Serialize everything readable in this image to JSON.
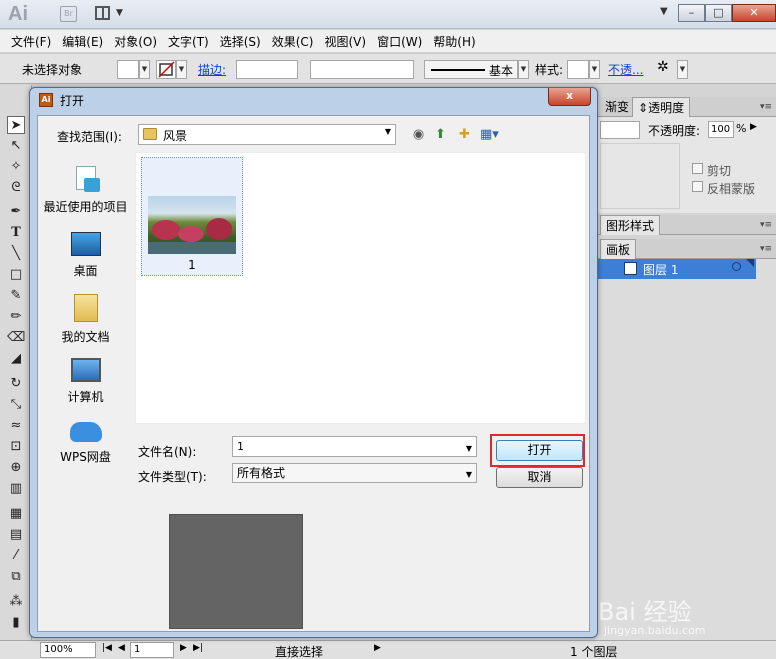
{
  "app": {
    "logo": "Ai",
    "bridge_label": "Br",
    "window_buttons": [
      "–",
      "□",
      "✕"
    ]
  },
  "menubar": [
    "文件(F)",
    "编辑(E)",
    "对象(O)",
    "文字(T)",
    "选择(S)",
    "效果(C)",
    "视图(V)",
    "窗口(W)",
    "帮助(H)"
  ],
  "controlbar": {
    "selection": "未选择对象",
    "stroke_label": "描边:",
    "stroke_style": "基本",
    "style_label": "样式:",
    "opacity_link": "不透..."
  },
  "panels": {
    "tab_gradient": "渐变",
    "tab_transparency": "透明度",
    "opacity_label": "不透明度:",
    "opacity_value": "100",
    "opacity_unit": "%",
    "clip_label": "剪切",
    "invert_label": "反相蒙版",
    "graphic_styles": "图形样式",
    "artboards": "画板",
    "layer_name": "图层 1"
  },
  "statusbar": {
    "zoom": "100%",
    "page": "1",
    "tool": "直接选择",
    "layer_count": "1 个图层"
  },
  "dialog": {
    "title": "打开",
    "title_icon": "Ai",
    "close": "x",
    "lookin_label": "查找范围(I):",
    "lookin_value": "风景",
    "places": [
      "最近使用的项目",
      "桌面",
      "我的文档",
      "计算机",
      "WPS网盘"
    ],
    "files": [
      {
        "name": "1"
      }
    ],
    "filename_label": "文件名(N):",
    "filename_value": "1",
    "filetype_label": "文件类型(T):",
    "filetype_value": "所有格式",
    "open_button": "打开",
    "cancel_button": "取消"
  },
  "watermark": {
    "text": "Bai 经验",
    "sub": "jingyan.baidu.com"
  }
}
